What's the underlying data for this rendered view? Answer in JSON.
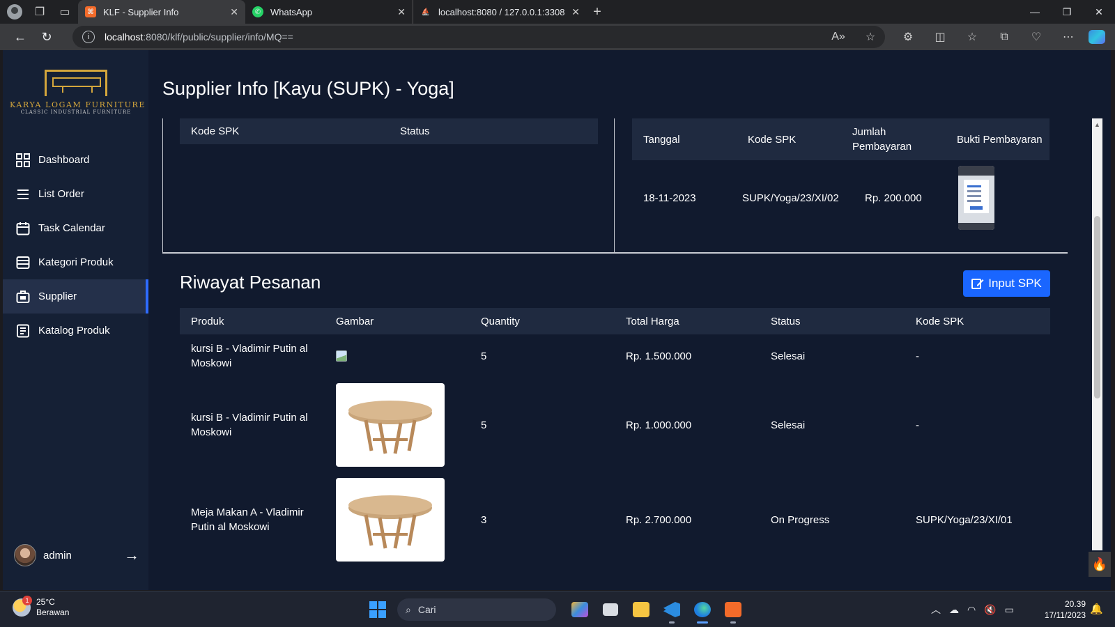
{
  "browser": {
    "tabs": [
      {
        "label": "KLF - Supplier Info",
        "active": true,
        "favicon_color": "#f36b2a"
      },
      {
        "label": "WhatsApp",
        "active": false,
        "favicon_color": "#25d366"
      },
      {
        "label": "localhost:8080 / 127.0.0.1:3308 /",
        "active": false,
        "favicon_color": "#e8a33c"
      }
    ],
    "url_host": "localhost",
    "url_path": ":8080/klf/public/supplier/info/MQ=="
  },
  "brand": {
    "name": "KARYA LOGAM FURNITURE",
    "tagline": "CLASSIC INDUSTRIAL FURNITURE",
    "accent": "#d4a63c"
  },
  "sidebar": {
    "items": [
      {
        "label": "Dashboard",
        "icon": "grid-icon"
      },
      {
        "label": "List Order",
        "icon": "list-icon"
      },
      {
        "label": "Task Calendar",
        "icon": "calendar-icon"
      },
      {
        "label": "Kategori Produk",
        "icon": "category-icon"
      },
      {
        "label": "Supplier",
        "icon": "supplier-icon",
        "active": true
      },
      {
        "label": "Katalog Produk",
        "icon": "catalog-icon"
      }
    ],
    "user": "admin"
  },
  "page": {
    "title": "Supplier Info [Kayu (SUPK) - Yoga]"
  },
  "spk_table": {
    "headers": [
      "Kode SPK",
      "Status"
    ]
  },
  "payment_table": {
    "headers": [
      "Tanggal",
      "Kode SPK",
      "Jumlah Pembayaran",
      "Bukti Pembayaran"
    ],
    "rows": [
      {
        "tanggal": "18-11-2023",
        "kode": "SUPK/Yoga/23/XI/02",
        "jumlah": "Rp. 200.000"
      }
    ]
  },
  "orders": {
    "title": "Riwayat Pesanan",
    "button": "Input SPK",
    "headers": [
      "Produk",
      "Gambar",
      "Quantity",
      "Total Harga",
      "Status",
      "Kode SPK"
    ],
    "rows": [
      {
        "produk": "kursi B - Vladimir Putin al Moskowi",
        "image": "broken",
        "qty": "5",
        "total": "Rp. 1.500.000",
        "status": "Selesai",
        "kode": "-"
      },
      {
        "produk": "kursi B - Vladimir Putin al Moskowi",
        "image": "table",
        "qty": "5",
        "total": "Rp. 1.000.000",
        "status": "Selesai",
        "kode": "-"
      },
      {
        "produk": "Meja Makan A - Vladimir Putin al Moskowi",
        "image": "table",
        "qty": "3",
        "total": "Rp. 2.700.000",
        "status": "On Progress",
        "kode": "SUPK/Yoga/23/XI/01"
      }
    ]
  },
  "taskbar": {
    "weather_temp": "25°C",
    "weather_desc": "Berawan",
    "weather_badge": "1",
    "search_placeholder": "Cari",
    "time": "20.39",
    "date": "17/11/2023"
  },
  "colors": {
    "app_bg": "#111a2e",
    "sidebar_bg": "#152035",
    "table_header": "#1f2a40",
    "primary_button": "#1a66ff"
  }
}
